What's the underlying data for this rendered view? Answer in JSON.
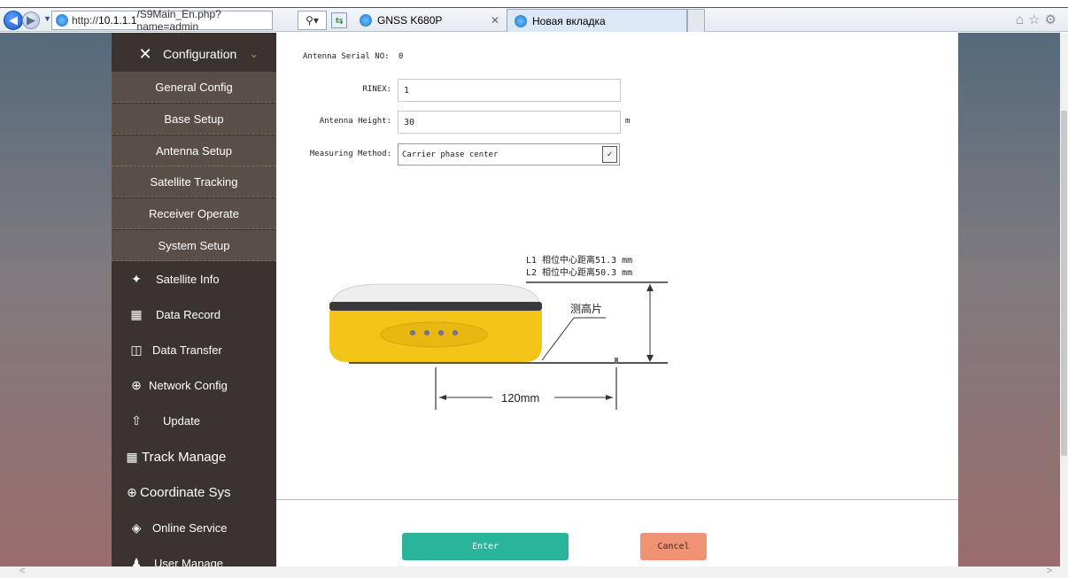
{
  "browser": {
    "url_prefix": "http://",
    "url_host": "10.1.1.1",
    "url_path": "/S9Main_En.php?name=admin",
    "tabs": [
      {
        "label": "GNSS K680P"
      },
      {
        "label": "Новая вкладка"
      }
    ]
  },
  "sidebar": {
    "config_label": "Configuration",
    "sub_items": [
      {
        "label": "General Config"
      },
      {
        "label": "Base Setup"
      },
      {
        "label": "Antenna Setup"
      },
      {
        "label": "Satellite Tracking"
      },
      {
        "label": "Receiver Operate"
      },
      {
        "label": "System Setup"
      }
    ],
    "items": [
      {
        "label": "Satellite Info",
        "icon": "satellite-icon"
      },
      {
        "label": "Data Record",
        "icon": "calendar-icon"
      },
      {
        "label": "Data Transfer",
        "icon": "computer-icon"
      },
      {
        "label": "Network Config",
        "icon": "globe-icon"
      },
      {
        "label": "Update",
        "icon": "upload-icon"
      },
      {
        "label": "Track Manage",
        "icon": "calendar-icon"
      },
      {
        "label": "Coordinate Sys",
        "icon": "globe-icon"
      },
      {
        "label": "Online Service",
        "icon": "cube-icon"
      },
      {
        "label": "User Manage",
        "icon": "user-icon"
      }
    ]
  },
  "form": {
    "serial_label": "Antenna Serial NO:",
    "serial_value": "0",
    "rinex_label": "RINEX:",
    "rinex_value": "1",
    "height_label": "Antenna Height:",
    "height_value": "30",
    "height_unit": "m",
    "method_label": "Measuring Method:",
    "method_value": "Carrier phase center"
  },
  "diagram": {
    "l1_text": "L1 相位中心距离51.3 mm",
    "l2_text": "L2 相位中心距离50.3 mm",
    "height_plate_label": "测高片",
    "width_label": "120mm",
    "colors": {
      "body": "#f2c418",
      "top": "#f2f2f2",
      "band": "#3a3a3a"
    }
  },
  "buttons": {
    "enter_label": "Enter",
    "cancel_label": "Cancel"
  }
}
